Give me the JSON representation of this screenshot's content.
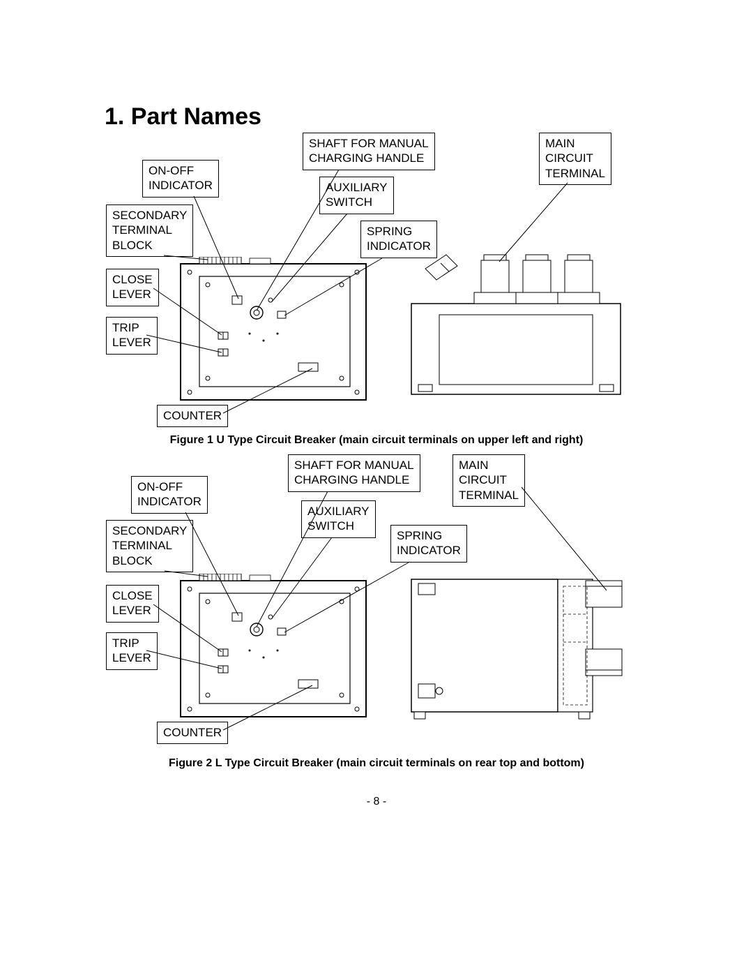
{
  "title": "1. Part Names",
  "page_number": "- 8 -",
  "figures": [
    {
      "caption": "Figure 1 U Type Circuit Breaker (main circuit terminals on upper left and right)",
      "labels": {
        "shaft_for_manual_charging_handle": "SHAFT FOR MANUAL\nCHARGING HANDLE",
        "main_circuit_terminal": "MAIN\nCIRCUIT\nTERMINAL",
        "on_off_indicator": "ON-OFF\nINDICATOR",
        "auxiliary_switch": "AUXILIARY\nSWITCH",
        "spring_indicator": "SPRING\nINDICATOR",
        "secondary_terminal_block": "SECONDARY\nTERMINAL\nBLOCK",
        "close_lever": "CLOSE\nLEVER",
        "trip_lever": "TRIP\nLEVER",
        "counter": "COUNTER"
      }
    },
    {
      "caption": "Figure 2 L Type Circuit Breaker (main circuit terminals on rear top and bottom)",
      "labels": {
        "shaft_for_manual_charging_handle": "SHAFT FOR MANUAL\nCHARGING HANDLE",
        "main_circuit_terminal": "MAIN\nCIRCUIT\nTERMINAL",
        "on_off_indicator": "ON-OFF\nINDICATOR",
        "auxiliary_switch": "AUXILIARY\nSWITCH",
        "spring_indicator": "SPRING\nINDICATOR",
        "secondary_terminal_block": "SECONDARY\nTERMINAL\nBLOCK",
        "close_lever": "CLOSE\nLEVER",
        "trip_lever": "TRIP\nLEVER",
        "counter": "COUNTER"
      }
    }
  ]
}
